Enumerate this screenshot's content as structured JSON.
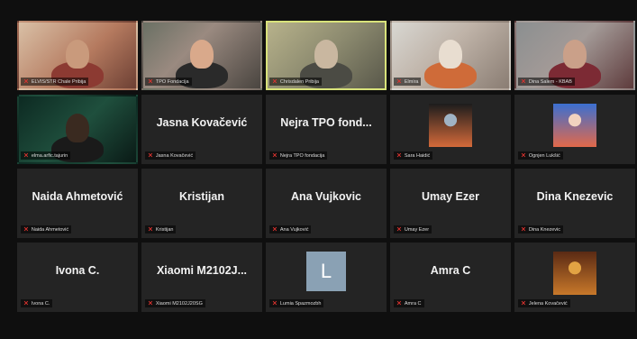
{
  "participants": [
    {
      "display": "",
      "caption": "ELVIS/STR Chale Pribija",
      "type": "video",
      "style": "v1",
      "head": "#c99a7c",
      "body": "#8c3a32"
    },
    {
      "display": "",
      "caption": "TPO Fondacija",
      "type": "video",
      "style": "v2",
      "head": "#d9a98b",
      "body": "#2a2a2a"
    },
    {
      "display": "",
      "caption": "Chrisdalen Pribija",
      "type": "video",
      "style": "v3",
      "head": "#c9b7a0",
      "body": "#4b4b44",
      "speaking": true
    },
    {
      "display": "",
      "caption": "Elmira",
      "type": "video",
      "style": "v4",
      "head": "#e8ddd0",
      "body": "#cf6b39"
    },
    {
      "display": "",
      "caption": "Dina Salem - KBAB",
      "type": "video",
      "style": "v5",
      "head": "#caa089",
      "body": "#7c2a34"
    },
    {
      "display": "",
      "caption": "elma.arfic.tajurin",
      "type": "video",
      "style": "v6",
      "head": "#3a2a20",
      "body": "#1a1a1a"
    },
    {
      "display": "Jasna Kovačević",
      "caption": "Jasna Kovačević",
      "type": "name"
    },
    {
      "display": "Nejra TPO fond...",
      "caption": "Nejra TPO fondacija",
      "type": "name"
    },
    {
      "display": "",
      "caption": "Sara Haidić",
      "type": "photo",
      "photo_colors": [
        "#1c1c1c",
        "#d46a3a",
        "#a0b3c4"
      ]
    },
    {
      "display": "",
      "caption": "Ognjen Lukšić",
      "type": "photo",
      "photo_colors": [
        "#3b6fd1",
        "#e2694a",
        "#f1d2bf"
      ]
    },
    {
      "display": "Naida Ahmetović",
      "caption": "Naida Ahmetović",
      "type": "name"
    },
    {
      "display": "Kristijan",
      "caption": "Kristijan",
      "type": "name"
    },
    {
      "display": "Ana Vujkovic",
      "caption": "Ana Vujković",
      "type": "name"
    },
    {
      "display": "Umay Ezer",
      "caption": "Umay Ezer",
      "type": "name"
    },
    {
      "display": "Dina Knezevic",
      "caption": "Dina Knezevic",
      "type": "name"
    },
    {
      "display": "Ivona C.",
      "caption": "Ivona C.",
      "type": "name"
    },
    {
      "display": "Xiaomi M2102J...",
      "caption": "Xiaomi M2102J20SG",
      "type": "name"
    },
    {
      "display": "",
      "caption": "Lumia Spazmozbh",
      "type": "letter",
      "letter": "L",
      "letter_bg": "#8aa1b4"
    },
    {
      "display": "Amra C",
      "caption": "Amra C",
      "type": "name"
    },
    {
      "display": "",
      "caption": "Jelena Kovačević",
      "type": "photo",
      "photo_colors": [
        "#5a2a14",
        "#c8782a",
        "#e2a343"
      ]
    }
  ],
  "icons": {
    "muted": "mic-muted-icon"
  },
  "colors": {
    "background": "#0f0f0f",
    "tile": "#242424",
    "speaking_border": "#d8e27a",
    "muted_icon": "#e0332f"
  }
}
